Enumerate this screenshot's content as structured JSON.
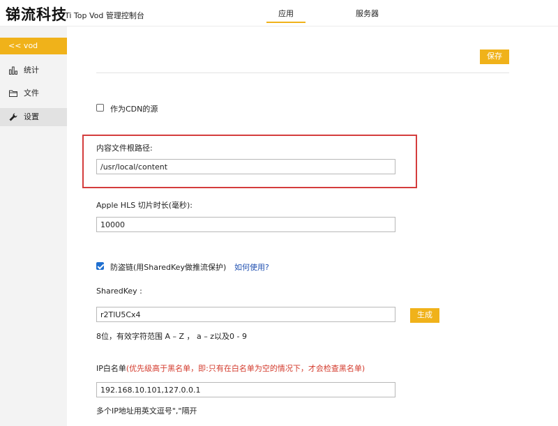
{
  "header": {
    "brand": "锑流科技",
    "subtitle": "Ti Top Vod 管理控制台",
    "tabs": [
      {
        "label": "应用",
        "active": true
      },
      {
        "label": "服务器",
        "active": false
      }
    ]
  },
  "sidebar": {
    "back_label": "<< vod",
    "items": [
      {
        "label": "统计",
        "icon": "bar-chart-icon"
      },
      {
        "label": "文件",
        "icon": "folder-icon"
      },
      {
        "label": "设置",
        "icon": "wrench-icon",
        "active": true
      }
    ]
  },
  "main": {
    "save_label": "保存",
    "cdn_source": {
      "label": "作为CDN的源",
      "checked": false
    },
    "content_root": {
      "label": "内容文件根路径:",
      "value": "/usr/local/content"
    },
    "hls_segment": {
      "label": "Apple HLS 切片时长(毫秒):",
      "value": "10000"
    },
    "anti_leech": {
      "label": "防盗链(用SharedKey做推流保护)",
      "checked": true,
      "link": "如何使用?"
    },
    "shared_key": {
      "label": "SharedKey :",
      "value": "r2TlU5Cx4",
      "generate_label": "生成",
      "hint": "8位，有效字符范围 A – Z ， a – z以及0 - 9"
    },
    "ip_whitelist": {
      "label": "IP白名单",
      "warning": "(优先级高于黑名单，即:只有在白名单为空的情况下，才会检查黑名单)",
      "value": "192.168.10.101,127.0.0.1",
      "hint": "多个IP地址用英文逗号\",\"隔开"
    }
  },
  "colors": {
    "accent": "#f0b21a",
    "highlight": "#d43c3c",
    "link": "#1f4fb0",
    "warning": "#d33a2c"
  }
}
